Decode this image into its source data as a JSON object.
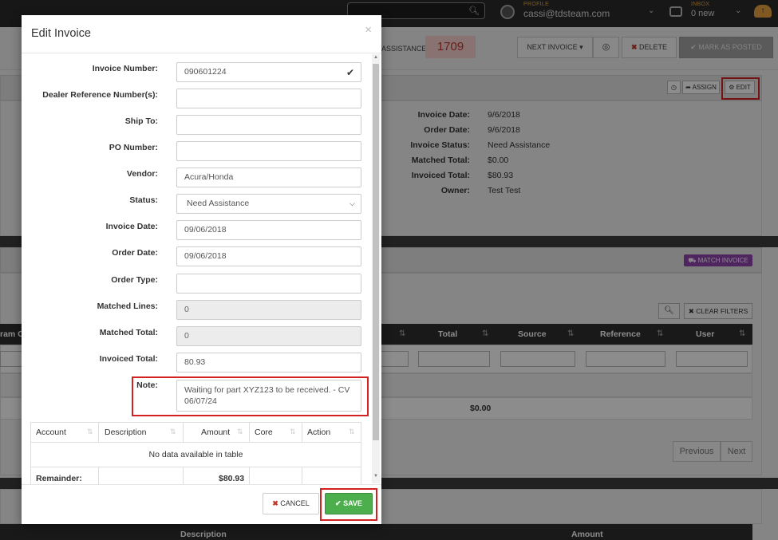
{
  "topbar": {
    "profile_caption": "PROFILE",
    "profile_email": "cassi@tdsteam.com",
    "inbox_caption": "INBOX",
    "inbox_count": "0 new"
  },
  "toolbar": {
    "assistance_label": "ASSISTANCE:",
    "assistance_count": "1709",
    "next_invoice": "NEXT INVOICE ▾",
    "delete": "DELETE",
    "mark_posted": "✔ MARK AS POSTED"
  },
  "invoice_panel": {
    "assign": "➦ ASSIGN",
    "edit": "⚙ EDIT",
    "details": [
      {
        "label": "Invoice Date:",
        "value": "9/6/2018"
      },
      {
        "label": "Order Date:",
        "value": "9/6/2018"
      },
      {
        "label": "Invoice Status:",
        "value": "Need Assistance"
      },
      {
        "label": "Matched Total:",
        "value": "$0.00"
      },
      {
        "label": "Invoiced Total:",
        "value": "$80.93"
      },
      {
        "label": "Owner:",
        "value": "Test Test"
      }
    ]
  },
  "lines_panel": {
    "match_invoice": "⛟ MATCH INVOICE",
    "clear_filters": "✖ CLEAR FILTERS",
    "partial_col": "ram C",
    "columns": [
      "Total",
      "Source",
      "Reference",
      "User"
    ],
    "footer_total": "$0.00",
    "prev": "Previous",
    "next": "Next",
    "bottom_cols": [
      "Description",
      "Amount"
    ]
  },
  "modal": {
    "title": "Edit Invoice",
    "close": "×",
    "fields": {
      "invoice_number": {
        "label": "Invoice Number:",
        "value": "090601224"
      },
      "dealer_ref": {
        "label": "Dealer Reference Number(s):",
        "value": ""
      },
      "ship_to": {
        "label": "Ship To:",
        "value": ""
      },
      "po_number": {
        "label": "PO Number:",
        "value": ""
      },
      "vendor": {
        "label": "Vendor:",
        "value": "Acura/Honda"
      },
      "status": {
        "label": "Status:",
        "value": "Need Assistance"
      },
      "invoice_date": {
        "label": "Invoice Date:",
        "value": "09/06/2018"
      },
      "order_date": {
        "label": "Order Date:",
        "value": "09/06/2018"
      },
      "order_type": {
        "label": "Order Type:",
        "value": ""
      },
      "matched_lines": {
        "label": "Matched Lines:",
        "value": "0"
      },
      "matched_total": {
        "label": "Matched Total:",
        "value": "0"
      },
      "invoiced_total": {
        "label": "Invoiced Total:",
        "value": "80.93"
      },
      "note": {
        "label": "Note:",
        "value": "Waiting for part XYZ123 to be received. - CV 06/07/24"
      }
    },
    "table": {
      "columns": [
        "Account",
        "Description",
        "Amount",
        "Core",
        "Action"
      ],
      "empty": "No data available in table",
      "remainder_label": "Remainder:",
      "remainder_value": "$80.93"
    },
    "cancel": "CANCEL",
    "save": "✔ SAVE"
  }
}
